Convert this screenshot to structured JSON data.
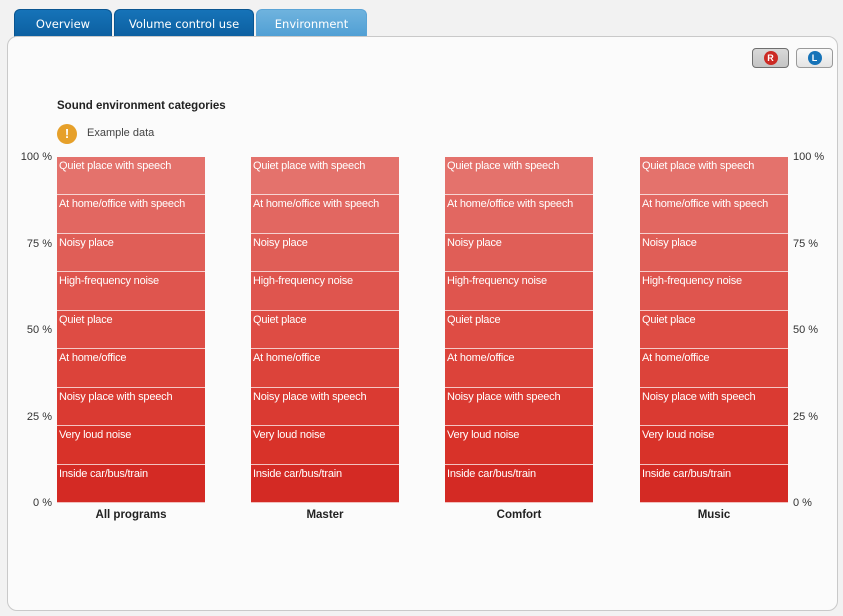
{
  "tabs": [
    {
      "label": "Overview",
      "active": false
    },
    {
      "label": "Volume control use",
      "active": false
    },
    {
      "label": "Environment",
      "active": true
    }
  ],
  "ear_buttons": [
    {
      "letter": "R",
      "color": "#cc2a24",
      "pressed": true
    },
    {
      "letter": "L",
      "color": "#1673b8",
      "pressed": false
    }
  ],
  "section_title": "Sound environment categories",
  "notice": {
    "icon": "warning-icon",
    "glyph": "!",
    "text": "Example data"
  },
  "chart_data": {
    "type": "bar",
    "stacked": true,
    "percent": true,
    "categories": [
      "All programs",
      "Master",
      "Comfort",
      "Music"
    ],
    "series": [
      {
        "name": "Inside car/bus/train",
        "values": [
          11.11,
          11.11,
          11.11,
          11.11
        ]
      },
      {
        "name": "Very loud noise",
        "values": [
          11.11,
          11.11,
          11.11,
          11.11
        ]
      },
      {
        "name": "Noisy place with speech",
        "values": [
          11.11,
          11.11,
          11.11,
          11.11
        ]
      },
      {
        "name": "At home/office",
        "values": [
          11.11,
          11.11,
          11.11,
          11.11
        ]
      },
      {
        "name": "Quiet place",
        "values": [
          11.11,
          11.11,
          11.11,
          11.11
        ]
      },
      {
        "name": "High-frequency noise",
        "values": [
          11.11,
          11.11,
          11.11,
          11.11
        ]
      },
      {
        "name": "Noisy place",
        "values": [
          11.11,
          11.11,
          11.11,
          11.11
        ]
      },
      {
        "name": "At home/office with speech",
        "values": [
          11.11,
          11.11,
          11.11,
          11.11
        ]
      },
      {
        "name": "Quiet place with speech",
        "values": [
          11.11,
          11.11,
          11.11,
          11.11
        ]
      }
    ],
    "colors": [
      "#d42a24",
      "#d83229",
      "#da3a32",
      "#dc433a",
      "#de4c44",
      "#df554e",
      "#e05e57",
      "#e26761",
      "#e4726c"
    ],
    "y_ticks": [
      "0 %",
      "25 %",
      "50 %",
      "75 %",
      "100 %"
    ],
    "ylim": [
      0,
      100
    ]
  }
}
